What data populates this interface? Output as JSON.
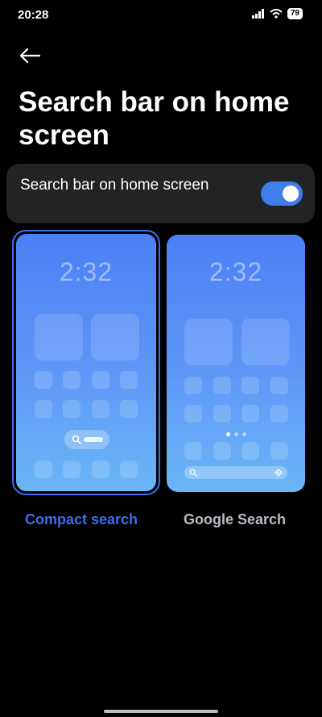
{
  "status_bar": {
    "time": "20:28",
    "battery": "79"
  },
  "header": {
    "title": "Search bar on home screen"
  },
  "setting": {
    "label": "Search bar on home screen",
    "enabled": true
  },
  "options": [
    {
      "label": "Compact search",
      "preview_clock": "2:32",
      "selected": true
    },
    {
      "label": "Google Search",
      "preview_clock": "2:32",
      "selected": false
    }
  ],
  "colors": {
    "accent": "#3b6ef0",
    "card": "#222324",
    "background": "#000000"
  }
}
